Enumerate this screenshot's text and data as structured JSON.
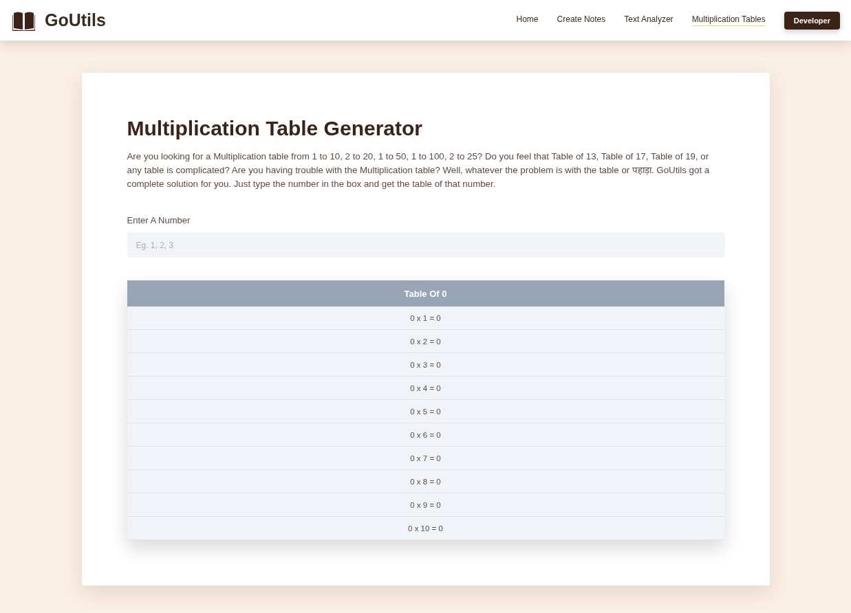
{
  "brand": {
    "name": "GoUtils"
  },
  "nav": [
    {
      "label": "Home",
      "selected": false
    },
    {
      "label": "Create Notes",
      "selected": false
    },
    {
      "label": "Text Analyzer",
      "selected": false
    },
    {
      "label": "Multiplication Tables",
      "selected": true
    }
  ],
  "developer_button": "Developer",
  "title": "Multiplication Table Generator",
  "intro": "Are you looking for a Multiplication table from 1 to 10, 2 to 20, 1 to 50, 1 to 100, 2 to 25? Do you feel that Table of 13, Table of 17, Table of 19, or any table is complicated? Are you having trouble with the Multiplication table? Well, whatever the problem is with the table or पहाड़ा. GoUtils got a complete solution for you. Just type the number in the box and get the table of that number.",
  "number_field": {
    "label": "Enter A Number",
    "placeholder": "Eg. 1, 2, 3"
  },
  "table": {
    "heading": "Table Of 0",
    "rows": [
      "0 x 1 = 0",
      "0 x 2 = 0",
      "0 x 3 = 0",
      "0 x 4 = 0",
      "0 x 5 = 0",
      "0 x 6 = 0",
      "0 x 7 = 0",
      "0 x 8 = 0",
      "0 x 9 = 0",
      "0 x 10 = 0"
    ]
  }
}
